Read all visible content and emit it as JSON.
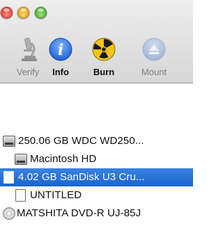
{
  "window": {
    "controls": [
      "close",
      "minimize",
      "zoom"
    ]
  },
  "toolbar": {
    "items": [
      {
        "label": "Verify",
        "icon": "microscope-icon",
        "state": "disabled"
      },
      {
        "label": "Info",
        "icon": "info-icon",
        "state": "active"
      },
      {
        "label": "Burn",
        "icon": "radiation-icon",
        "state": "active"
      },
      {
        "label": "Mount",
        "icon": "eject-icon",
        "state": "disabled"
      }
    ]
  },
  "sidebar": {
    "items": [
      {
        "label": "250.06 GB WDC WD250...",
        "icon": "hard-disk-icon",
        "level": 0,
        "selected": false
      },
      {
        "label": "Macintosh HD",
        "icon": "hard-disk-icon",
        "level": 1,
        "selected": false
      },
      {
        "label": "4.02 GB SanDisk U3 Cru...",
        "icon": "external-volume-icon",
        "level": 0,
        "selected": true
      },
      {
        "label": "UNTITLED",
        "icon": "volume-icon",
        "level": 1,
        "selected": false
      },
      {
        "label": "MATSHITA DVD-R UJ-85J",
        "icon": "optical-disc-icon",
        "level": 0,
        "selected": false
      }
    ]
  },
  "colors": {
    "selection": "#1964cf",
    "info_blue": "#2a6fd6",
    "burn_yellow": "#f2c418",
    "mount_blue": "#7aa2d8"
  }
}
